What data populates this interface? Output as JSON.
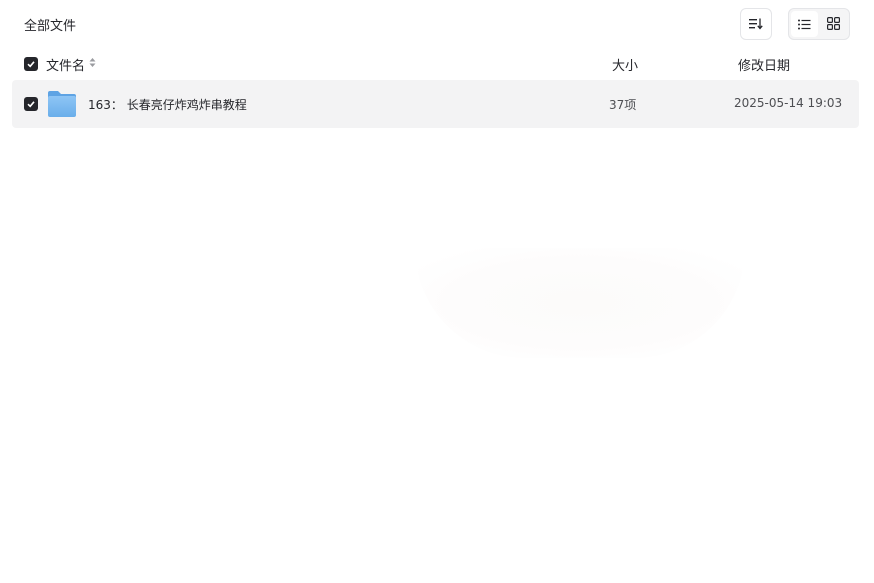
{
  "breadcrumb": {
    "title": "全部文件"
  },
  "toolbar": {
    "sort_icon": "sort-icon",
    "view_list_icon": "list-view-icon",
    "view_grid_icon": "grid-view-icon",
    "active_view": "list"
  },
  "table": {
    "columns": {
      "name": "文件名",
      "size": "大小",
      "date": "修改日期"
    },
    "rows": [
      {
        "name": "163： 长春亮仔炸鸡炸串教程",
        "size": "37项",
        "date": "2025-05-14 19:03",
        "type": "folder",
        "checked": true
      }
    ],
    "select_all_checked": true
  },
  "colors": {
    "folder": "#7cb8f0",
    "checkbox": "#25262b",
    "row_bg": "#f3f3f4"
  }
}
